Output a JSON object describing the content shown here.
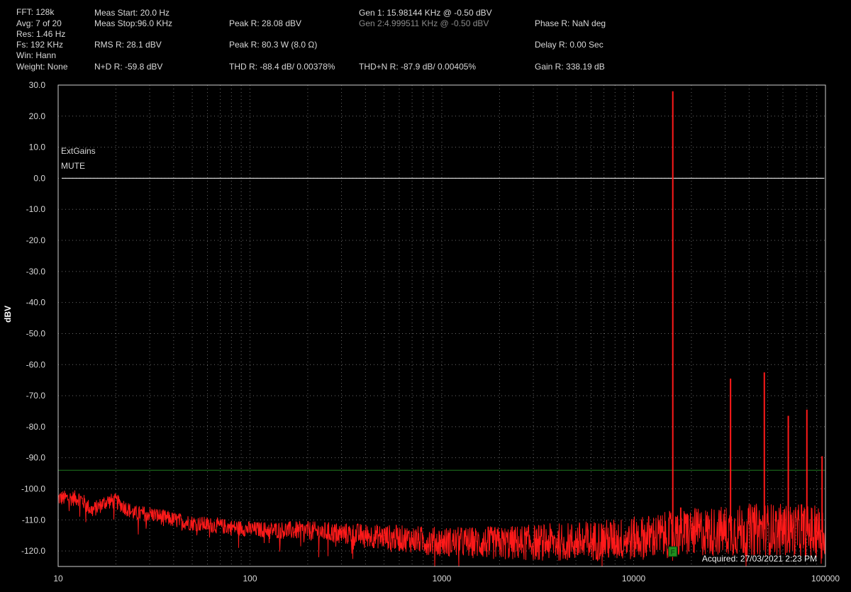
{
  "header": {
    "fft": "FFT: 128k",
    "avg": "Avg: 7 of 20",
    "res": "Res: 1.46 Hz",
    "fs": "Fs: 192 KHz",
    "win": "Win: Hann",
    "weight": "Weight: None",
    "meas_start": "Meas Start: 20.0 Hz",
    "meas_stop": "Meas Stop:96.0 KHz",
    "rms": "RMS R: 28.1 dBV",
    "nd": "N+D R: -59.8 dBV",
    "peak_dbv": "Peak R: 28.08 dBV",
    "peak_w": "Peak R: 80.3 W (8.0 Ω)",
    "thd": "THD R: -88.4 dB/ 0.00378%",
    "gen1": "Gen 1: 15.98144 KHz @ -0.50  dBV",
    "gen2": "Gen 2:4.999511 KHz @ -0.50  dBV",
    "thdn": "THD+N R: -87.9 dB/ 0.00405%",
    "phase": "Phase R: NaN deg",
    "delay": "Delay R: 0.00 Sec",
    "gain": "Gain R: 338.19 dB"
  },
  "colors": {
    "background": "#000000",
    "spectrum": "#ff1a1a",
    "grid": "#6a6a6a",
    "threshold_line": "#1f7a1f",
    "reference_line": "#ffffff",
    "marker_fill": "#1f8f1f"
  },
  "chart_data": {
    "type": "line",
    "title": "",
    "xlabel": "",
    "ylabel": "dBV",
    "x_scale": "log",
    "xlim": [
      10,
      100000
    ],
    "ylim": [
      -125,
      30
    ],
    "grid": true,
    "x_ticks": [
      "10",
      "100",
      "1000",
      "10000",
      "100000"
    ],
    "y_ticks": [
      "30.0",
      "20.0",
      "10.0",
      "0.0",
      "-10.0",
      "-20.0",
      "-30.0",
      "-40.0",
      "-50.0",
      "-60.0",
      "-70.0",
      "-80.0",
      "-90.0",
      "-100.0",
      "-110.0",
      "-120.0"
    ],
    "annotations": [
      "ExtGains",
      "MUTE"
    ],
    "reference_line_level": 0,
    "threshold_line_level": -94,
    "marker_label": "F",
    "marker_freq": 16000,
    "acquired": "Acquired: 27/03/2021  2:23 PM",
    "series": [
      {
        "noise_floor": [
          [
            10,
            -103
          ],
          [
            13,
            -103
          ],
          [
            15,
            -107
          ],
          [
            18,
            -104
          ],
          [
            20,
            -104
          ],
          [
            25,
            -108
          ],
          [
            30,
            -108
          ],
          [
            40,
            -110
          ],
          [
            50,
            -111
          ],
          [
            70,
            -112
          ],
          [
            100,
            -113
          ],
          [
            200,
            -113.5
          ],
          [
            500,
            -115.5
          ],
          [
            1000,
            -117
          ],
          [
            2000,
            -117.5
          ],
          [
            5000,
            -117
          ],
          [
            10000,
            -116
          ],
          [
            20000,
            -114
          ],
          [
            50000,
            -113
          ],
          [
            100000,
            -114
          ]
        ],
        "peaks": [
          [
            16000,
            28
          ],
          [
            16800,
            -109
          ],
          [
            17600,
            -106
          ],
          [
            19000,
            -108
          ],
          [
            32000,
            -64.5
          ],
          [
            48000,
            -62.5
          ],
          [
            64000,
            -76.5
          ],
          [
            75000,
            -105
          ],
          [
            80000,
            -74.5
          ],
          [
            90000,
            -108
          ],
          [
            96000,
            -89.5
          ]
        ]
      }
    ]
  }
}
